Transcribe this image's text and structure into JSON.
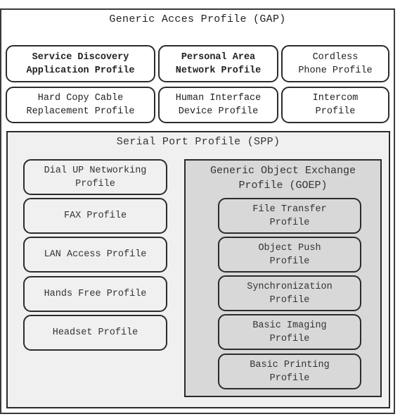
{
  "gap": {
    "title": "Generic Acces Profile (GAP)",
    "profiles": [
      {
        "label": "Service Discovery\nApplication Profile",
        "bold": true
      },
      {
        "label": "Personal Area\nNetwork Profile",
        "bold": true
      },
      {
        "label": "Cordless\nPhone Profile",
        "bold": false
      },
      {
        "label": "Hard Copy Cable\nReplacement Profile",
        "bold": false
      },
      {
        "label": "Human Interface\nDevice Profile",
        "bold": false
      },
      {
        "label": "Intercom\nProfile",
        "bold": false
      }
    ]
  },
  "spp": {
    "title": "Serial Port Profile (SPP)",
    "profiles": [
      {
        "label": "Dial UP Networking\nProfile"
      },
      {
        "label": "FAX Profile"
      },
      {
        "label": "LAN Access Profile"
      },
      {
        "label": "Hands Free Profile"
      },
      {
        "label": "Headset Profile"
      }
    ]
  },
  "goep": {
    "title": "Generic Object Exchange\nProfile (GOEP)",
    "profiles": [
      {
        "label": "File Transfer\nProfile"
      },
      {
        "label": "Object Push\nProfile"
      },
      {
        "label": "Synchronization\nProfile"
      },
      {
        "label": "Basic Imaging\nProfile"
      },
      {
        "label": "Basic Printing\nProfile"
      }
    ]
  },
  "colors": {
    "gap_bg": "#ffffff",
    "spp_bg": "#f0f0f0",
    "goep_bg": "#d8d8d8",
    "border": "#2c2c2c"
  }
}
